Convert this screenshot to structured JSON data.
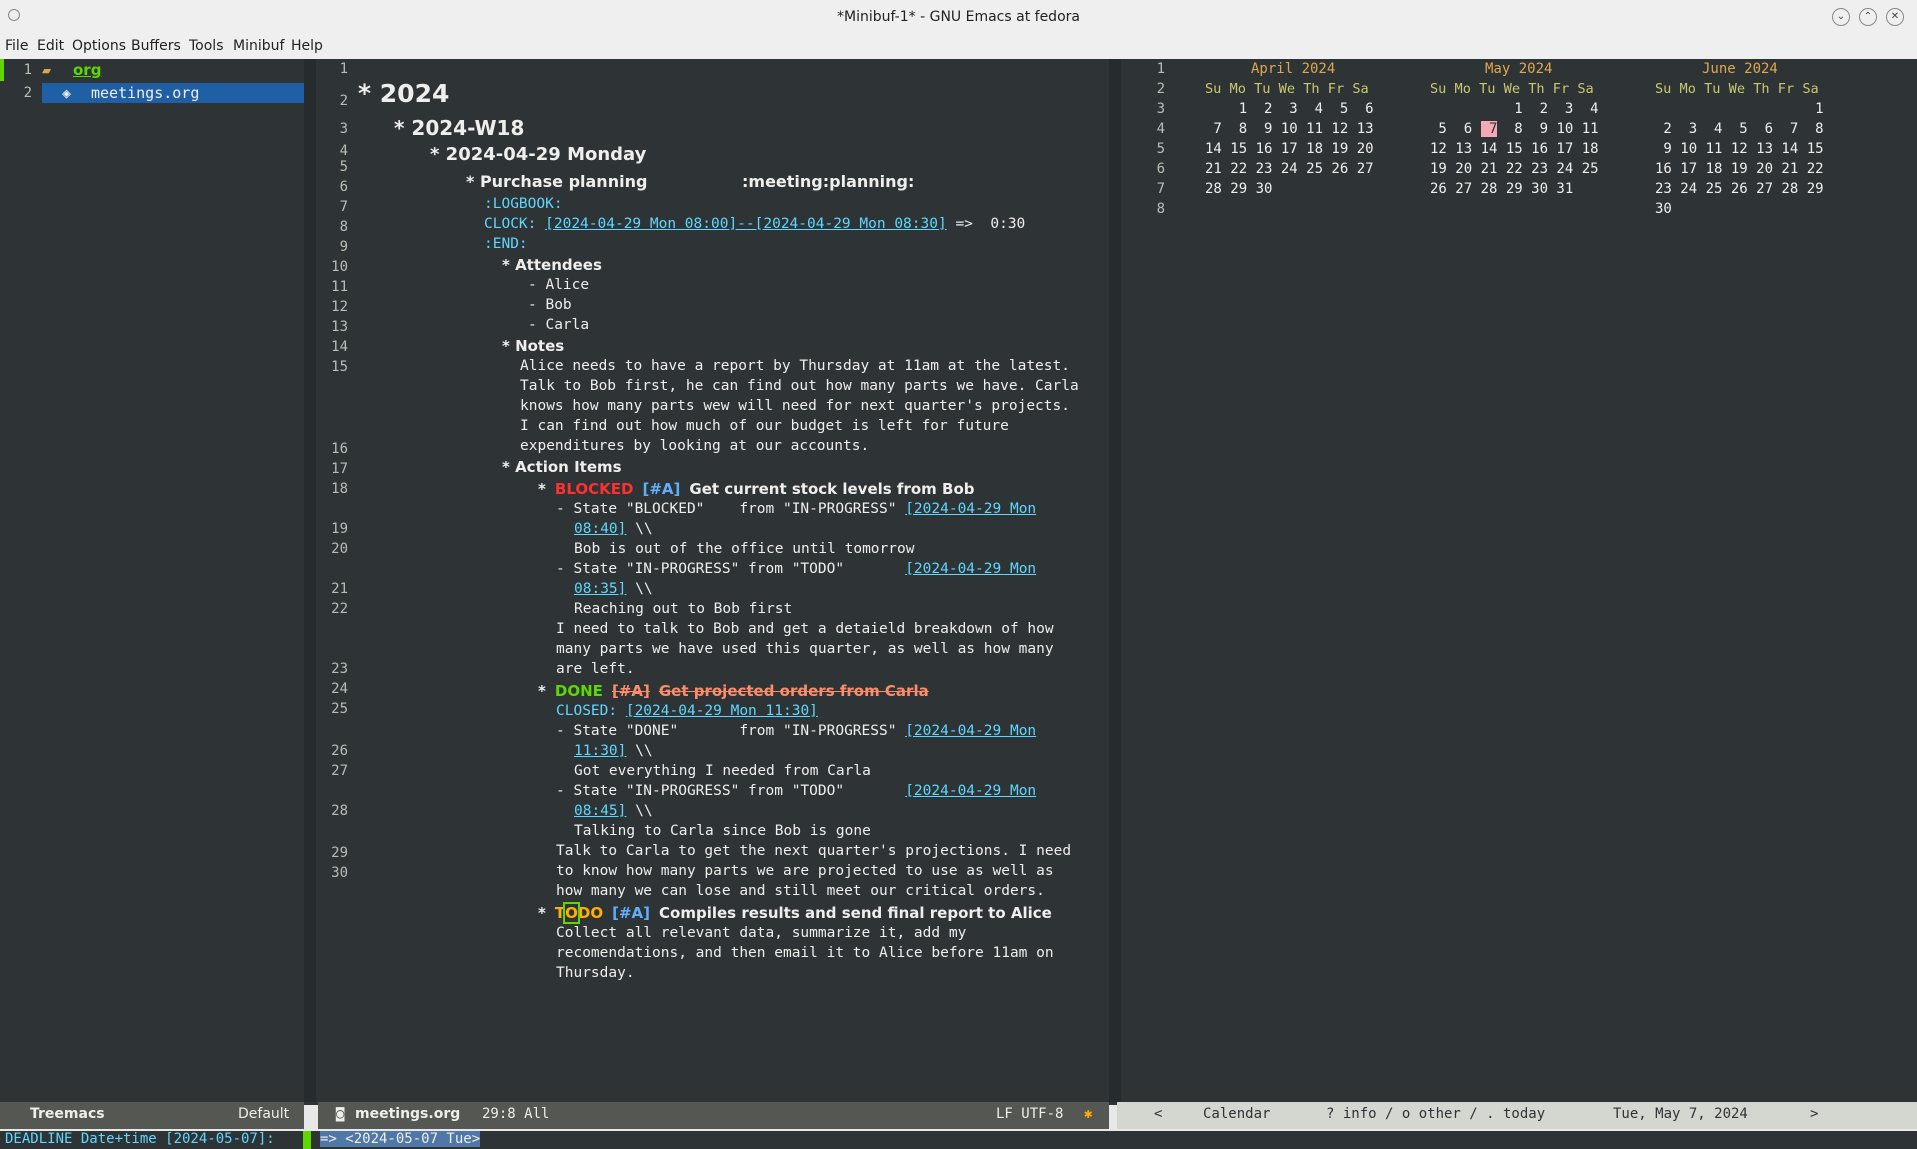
{
  "window": {
    "title": "*Minibuf-1* - GNU Emacs at fedora"
  },
  "menu": [
    "File",
    "Edit",
    "Options",
    "Buffers",
    "Tools",
    "Minibuf",
    "Help"
  ],
  "treemacs": {
    "lines": [
      {
        "num": "1",
        "label": "org"
      },
      {
        "num": "2",
        "label": "meetings.org"
      }
    ],
    "modeline_name": "Treemacs",
    "modeline_right": "Default"
  },
  "editor": {
    "modeline_buffer": "meetings.org",
    "modeline_pos": "29:8 All",
    "modeline_encoding": "LF UTF-8",
    "line_numbers": [
      "1",
      "2",
      "3",
      "4",
      "5",
      "6",
      "7",
      "8",
      "9",
      "10",
      "11",
      "12",
      "13",
      "14",
      "15",
      "16",
      "17",
      "18",
      "19",
      "20",
      "21",
      "22",
      "23",
      "24",
      "25",
      "26",
      "27",
      "28",
      "29",
      "30"
    ],
    "h1": "* 2024",
    "h2": "* 2024-W18",
    "h3": "* 2024-04-29 Monday",
    "h4_title": "* Purchase planning",
    "h4_tags": ":meeting:planning:",
    "logbook": ":LOGBOOK:",
    "clock_label": "CLOCK:",
    "clock_range": "[2024-04-29 Mon 08:00]--[2024-04-29 Mon 08:30]",
    "clock_arrow": "=>  0:30",
    "end": ":END:",
    "attendees": "* Attendees",
    "att1": "- Alice",
    "att2": "- Bob",
    "att3": "- Carla",
    "notes": "* Notes",
    "notes_lines": [
      "Alice needs to have a report by Thursday at 11am at the latest.",
      "Talk to Bob first, he can find out how many parts we have. Carla",
      "knows how many parts wew will need for next quarter's projects.",
      "I can find out how much of our budget is left for future",
      "expenditures by looking at our accounts."
    ],
    "action_items": "* Action Items",
    "task1": {
      "star": "*",
      "kw": "BLOCKED",
      "prio": "[#A]",
      "title": "Get current stock levels from Bob"
    },
    "t1_l17a": "- State \"BLOCKED\"    from \"IN-PROGRESS\" ",
    "t1_l17_link": "[2024-04-29 Mon",
    "t1_l17b_link": "08:40]",
    "backslash": " \\\\",
    "t1_l18": "Bob is out of the office until tomorrow",
    "t1_l19a": "- State \"IN-PROGRESS\" from \"TODO\"       ",
    "t1_l19_link": "[2024-04-29 Mon",
    "t1_l19b_link": "08:35]",
    "t1_l20": "Reaching out to Bob first",
    "t1_body": [
      "I need to talk to Bob and get a detaield breakdown of how",
      "many parts we have used this quarter, as well as how many",
      "are left."
    ],
    "task2": {
      "star": "*",
      "kw": "DONE",
      "prio": "[#A]",
      "title": "Get projected orders from Carla"
    },
    "closed_label": "CLOSED:",
    "closed_ts": "[2024-04-29 Mon 11:30]",
    "t2_l24a": "- State \"DONE\"       from \"IN-PROGRESS\" ",
    "t2_l24_link": "[2024-04-29 Mon",
    "t2_l24b_link": "11:30]",
    "t2_l25": "Got everything I needed from Carla",
    "t2_l26a": "- State \"IN-PROGRESS\" from \"TODO\"       ",
    "t2_l26_link": "[2024-04-29 Mon",
    "t2_l26b_link": "08:45]",
    "t2_l27": "Talking to Carla since Bob is gone",
    "t2_body": [
      "Talk to Carla to get the next quarter's projections. I need",
      "to know how many parts we are projected to use as well as",
      "how many we can lose and still meet our critical orders."
    ],
    "task3": {
      "star": "*",
      "kw_a": "T",
      "kw_b": "O",
      "kw_c": "DO",
      "prio": "[#A]",
      "title": "Compiles results and send final report to Alice"
    },
    "t3_body": [
      "Collect all relevant data, summarize it, add my",
      "recomendations, and then email it to Alice before 11am on",
      "Thursday."
    ]
  },
  "calendar": {
    "line_numbers": [
      "1",
      "2",
      "3",
      "4",
      "5",
      "6",
      "7",
      "8"
    ],
    "months": [
      {
        "name": "April 2024",
        "header": "Su Mo Tu We Th Fr Sa",
        "weeks": [
          "    1  2  3  4  5  6",
          " 7  8  9 10 11 12 13",
          "14 15 16 17 18 19 20",
          "21 22 23 24 25 26 27",
          "28 29 30"
        ]
      },
      {
        "name": "May 2024",
        "header": "Su Mo Tu We Th Fr Sa",
        "weeks": [
          "          1  2  3  4",
          " 5  6 ",
          "12 13 14 15 16 17 18",
          "19 20 21 22 23 24 25",
          "26 27 28 29 30 31"
        ],
        "today": "7",
        "after_today": "  8  9 10 11"
      },
      {
        "name": "June 2024",
        "header": "Su Mo Tu We Th Fr Sa",
        "weeks": [
          "                   1",
          " 2  3  4  5  6  7  8",
          " 9 10 11 12 13 14 15",
          "16 17 18 19 20 21 22",
          "23 24 25 26 27 28 29",
          "30"
        ]
      }
    ],
    "modeline_left": "<",
    "modeline_name": "Calendar",
    "modeline_help": "? info / o other / . today",
    "modeline_date": "Tue, May 7, 2024",
    "modeline_right": ">"
  },
  "minibuffer": {
    "prompt": "DEADLINE Date+time [2024-05-07]: ",
    "value": "=> <2024-05-07 Tue>"
  },
  "colors": {
    "bg": "#2e3436",
    "accent": "#5fd7ff",
    "blocked": "#ff3030",
    "done": "#5fd700",
    "todo": "#ffb000"
  }
}
